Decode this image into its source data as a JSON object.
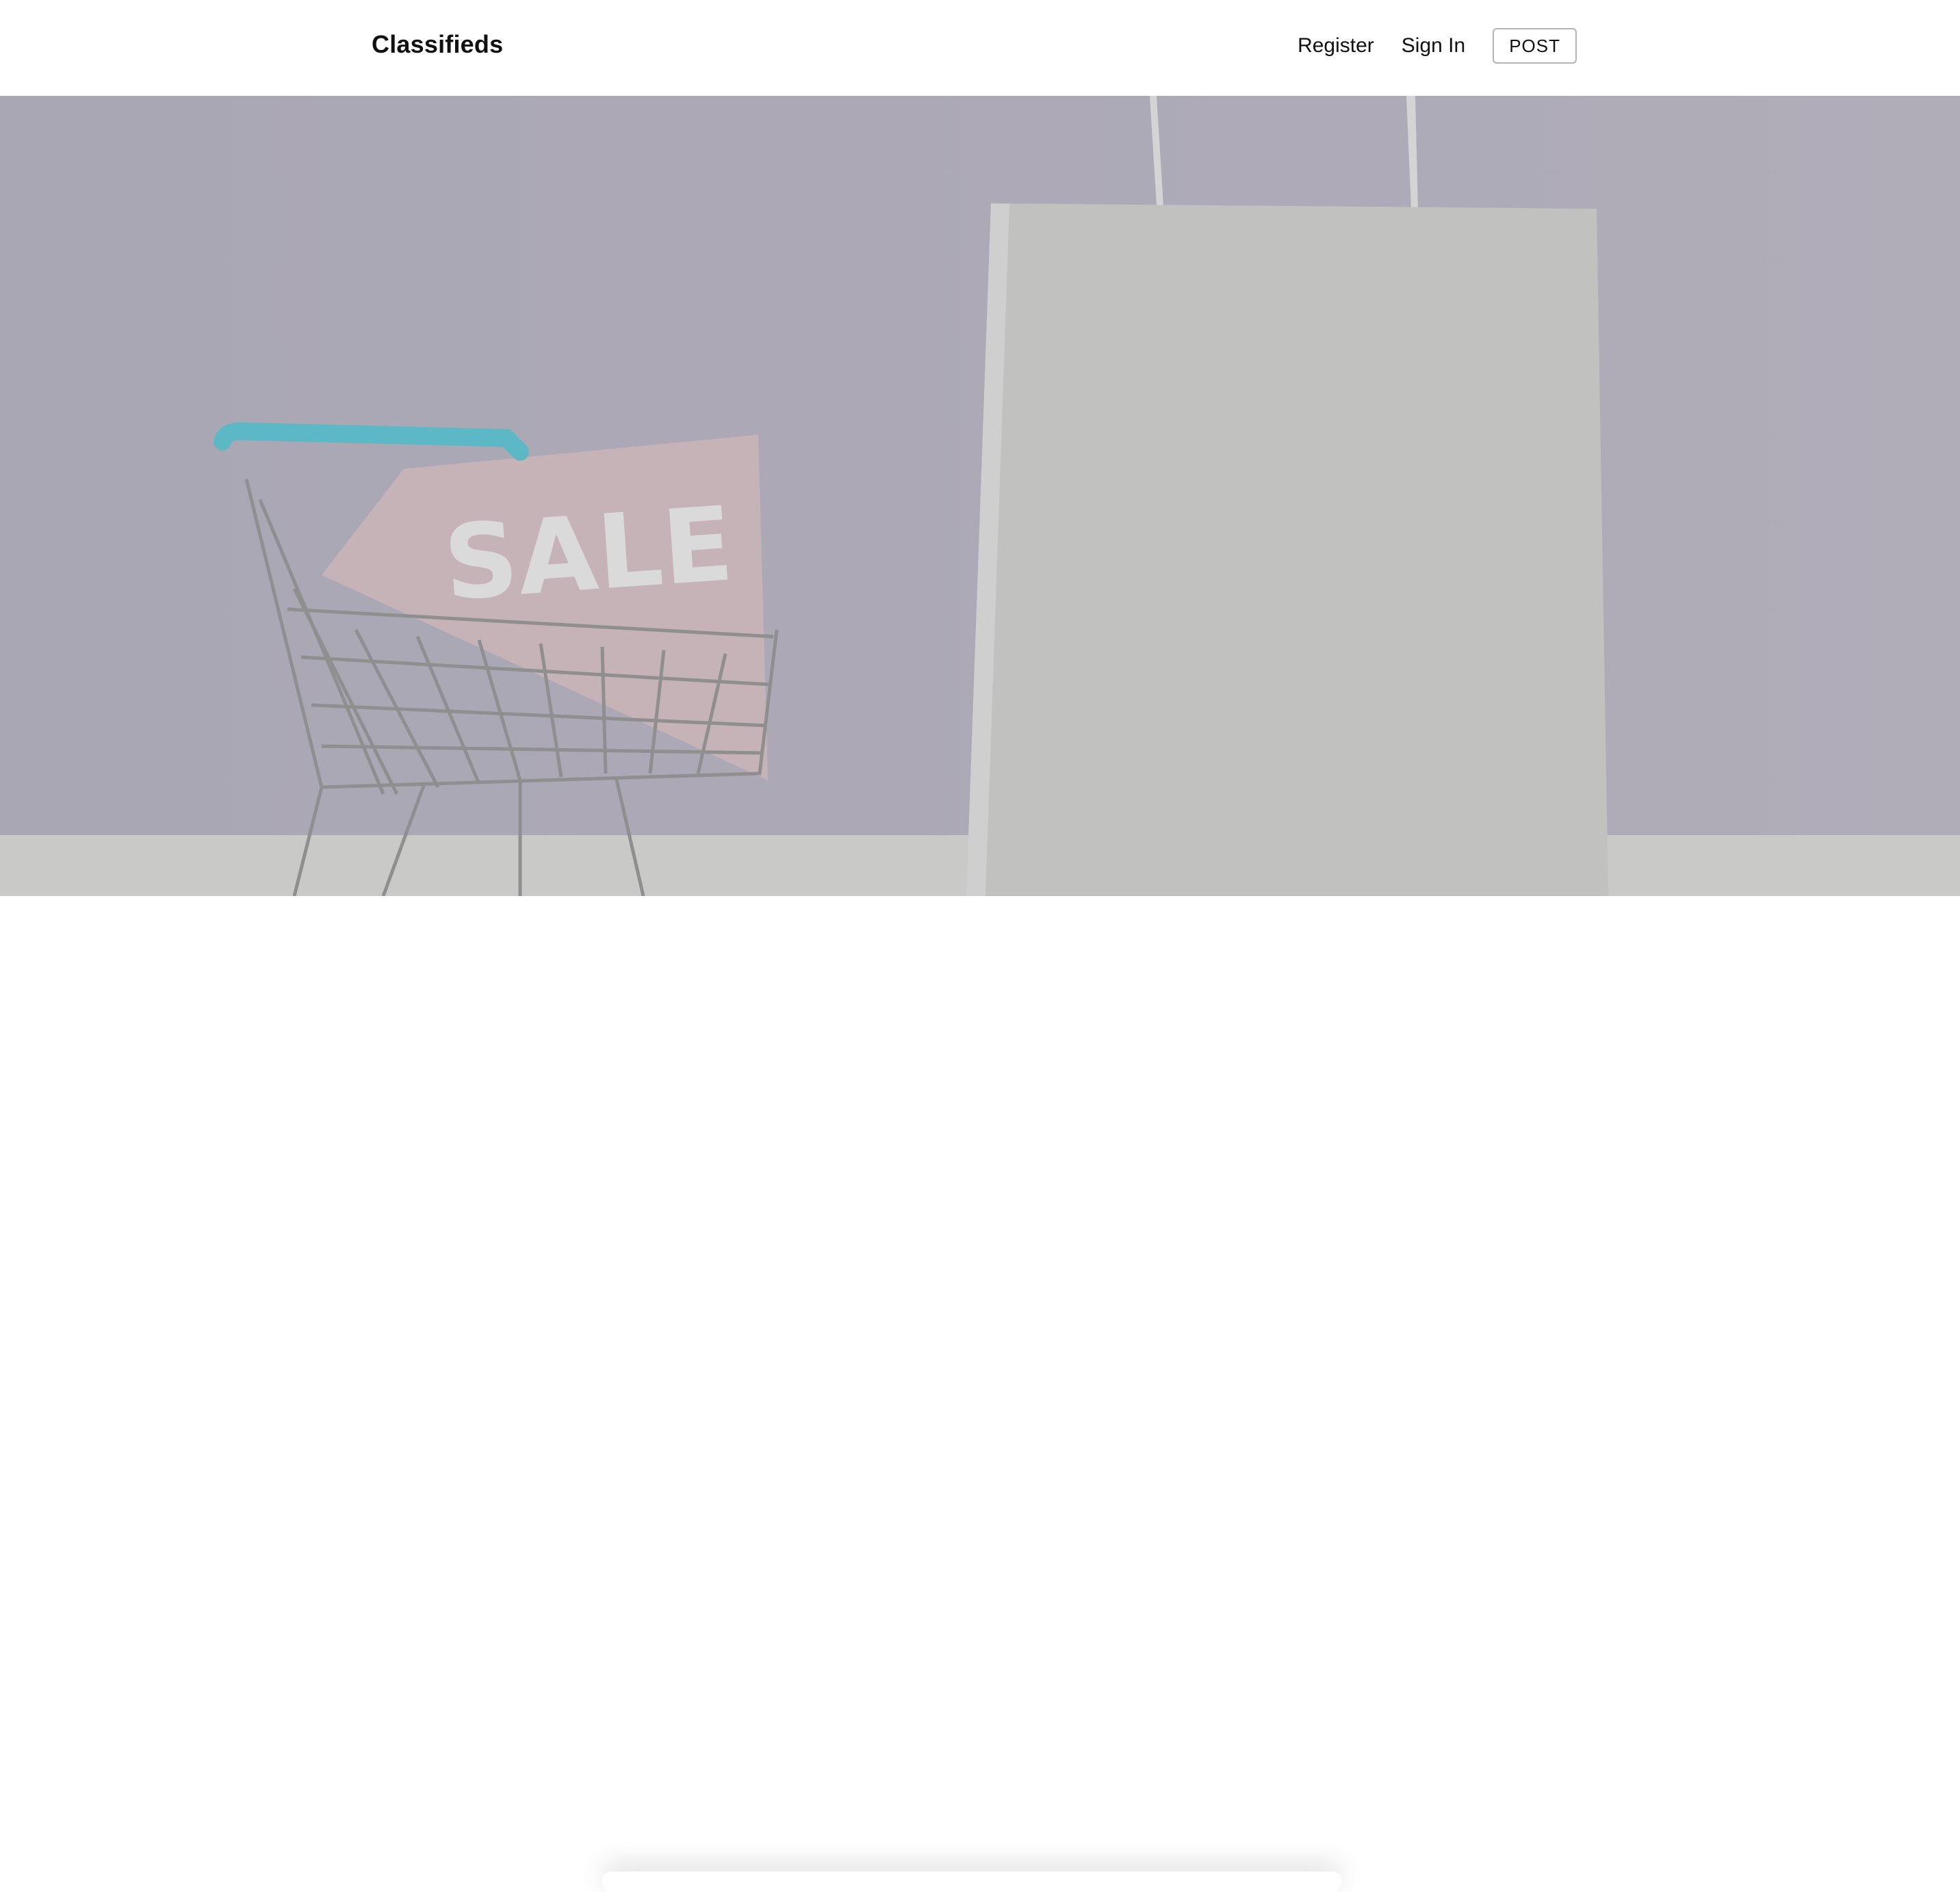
{
  "navbar": {
    "brand": "Classifieds",
    "links": {
      "register": "Register",
      "sign_in": "Sign In"
    },
    "post_label": "POST"
  },
  "hero": {
    "sale_text": "SALE"
  },
  "colors": {
    "hero_background": "#ababb7",
    "bag": "#bfbfbf",
    "cart_handle": "#5bb8c4",
    "sale_tag": "#c5b3b8",
    "post_border": "#b4b4b4"
  },
  "icons": [
    "shopping-cart-icon",
    "shopping-bag-icon",
    "sale-tag-icon"
  ]
}
